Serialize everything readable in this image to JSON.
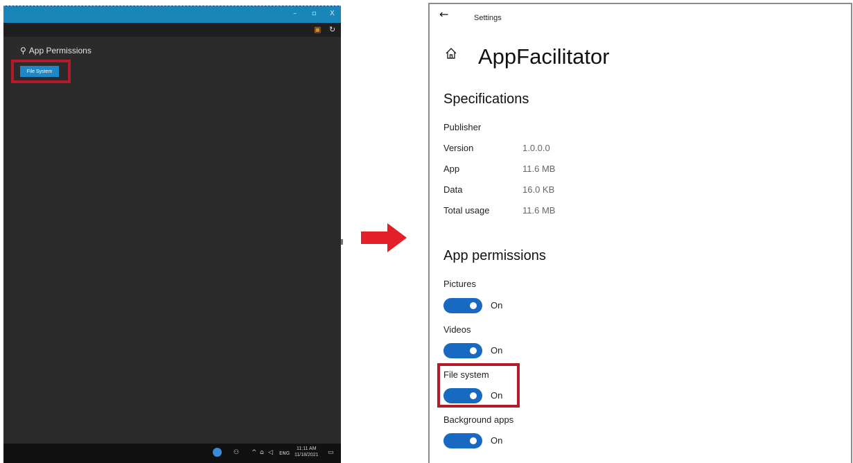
{
  "left_window": {
    "title_buttons": [
      "–",
      "▫",
      "X"
    ],
    "command_icons": [
      "clipboard-icon",
      "refresh-icon"
    ],
    "permissions_heading": "App Permissions",
    "file_system_button": "File System",
    "taskbar": {
      "lang": "ENG",
      "time": "11:11 AM",
      "date": "11/18/2021"
    }
  },
  "settings": {
    "window_title": "Settings",
    "app_name": "AppFacilitator",
    "specifications_heading": "Specifications",
    "specs": [
      {
        "label": "Publisher",
        "value": ""
      },
      {
        "label": "Version",
        "value": "1.0.0.0"
      },
      {
        "label": "App",
        "value": "11.6 MB"
      },
      {
        "label": "Data",
        "value": "16.0 KB"
      },
      {
        "label": "Total usage",
        "value": "11.6 MB"
      }
    ],
    "permissions_heading": "App permissions",
    "permissions": [
      {
        "label": "Pictures",
        "state": "On"
      },
      {
        "label": "Videos",
        "state": "On"
      },
      {
        "label": "File system",
        "state": "On"
      },
      {
        "label": "Background apps",
        "state": "On"
      }
    ]
  },
  "colors": {
    "highlight": "#b31b2b",
    "toggle_on": "#1769c2",
    "arrow": "#e3202a",
    "dark_bg": "#2b2b2b",
    "accent_blue": "#1a85b8"
  }
}
